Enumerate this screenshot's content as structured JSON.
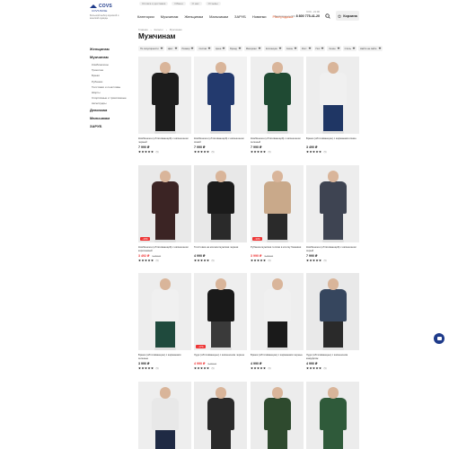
{
  "topbar": {
    "links": [
      "Оплата и доставка",
      "Обмен",
      "О нас",
      "Отзывы"
    ]
  },
  "header": {
    "brand": "COVS",
    "brand_sub": "COVS BASE",
    "tagline": "Большой выбор мужской и женской одежды",
    "nav": [
      "Категории",
      "Мужчинам",
      "Женщинам",
      "Мальчикам",
      "ЗАРУБ",
      "Новинки",
      "Распродажа"
    ],
    "hours": "9:00 - 21:00",
    "contact_label": "Бесплатно по РФ",
    "phone": "8 800 775-41-20",
    "cart_label": "Корзина"
  },
  "breadcrumb": [
    "Главная",
    "Каталог",
    "Мужчинам"
  ],
  "page_title": "Мужчинам",
  "sidebar": {
    "categories": [
      {
        "label": "Женщинам",
        "subs": []
      },
      {
        "label": "Мужчинам",
        "subs": [
          "Комбинезоны",
          "Трикотаж",
          "Брюки",
          "Рубашки",
          "Толстовки и лонгсливы",
          "Шорты",
          "Спортивные и трикотажные",
          "Аксессуары"
        ]
      },
      {
        "label": "Девочкам",
        "subs": []
      },
      {
        "label": "Мальчикам",
        "subs": []
      },
      {
        "label": "ЗАРУБ",
        "subs": []
      }
    ]
  },
  "filters": [
    "По популярности",
    "Цвет",
    "Размер",
    "Состав",
    "Цена",
    "Бренд",
    "Материал",
    "Коллекция",
    "Сезон",
    "Рост",
    "Пол",
    "Сезон",
    "Стиль",
    "Найти на сайте"
  ],
  "products": [
    {
      "name": "Комбинезон (обтягивающий) с капюшоном черный",
      "price": "7 990 ₽",
      "old": "",
      "rating_count": "(5)",
      "badge": "",
      "top": "#1d1d1d",
      "bottom": "#1d1d1d",
      "bg": "#eeeeee"
    },
    {
      "name": "Комбинезон (обтягивающий) с капюшоном синий",
      "price": "7 990 ₽",
      "old": "",
      "rating_count": "(5)",
      "badge": "",
      "top": "#233a6e",
      "bottom": "#233a6e",
      "bg": "#f2f2f2"
    },
    {
      "name": "Комбинезон (обтягивающий) с капюшоном зеленый",
      "price": "7 990 ₽",
      "old": "",
      "rating_count": "(5)",
      "badge": "",
      "top": "#1f4a33",
      "bottom": "#1f4a33",
      "bg": "#eeeeee"
    },
    {
      "name": "Брюки (обтягивающие) с карманами синие",
      "price": "3 490 ₽",
      "old": "",
      "rating_count": "(5)",
      "badge": "",
      "top": "#f0f0f0",
      "bottom": "#1f3664",
      "bg": "#ededed"
    },
    {
      "name": "Комбинезон (обтягивающий) с капюшоном коричневый",
      "price": "3 492 ₽",
      "old": "5 990 ₽",
      "rating_count": "(5)",
      "badge": "−40%",
      "top": "#3b2424",
      "bottom": "#3b2424",
      "bg": "#e9e9e9"
    },
    {
      "name": "Толстовка на молнии мужская черная",
      "price": "4 990 ₽",
      "old": "",
      "rating_count": "(5)",
      "badge": "",
      "top": "#1b1b1b",
      "bottom": "#2a2a2a",
      "bg": "#e8e8e8"
    },
    {
      "name": "Рубашка мужская теплая в клетку бежевая",
      "price": "3 990 ₽",
      "old": "5 990 ₽",
      "rating_count": "(5)",
      "badge": "−33%",
      "top": "#c9a98a",
      "bottom": "#2a2a2a",
      "bg": "#efefef"
    },
    {
      "name": "Комбинезон (обтягивающий) с капюшоном серый",
      "price": "7 990 ₽",
      "old": "",
      "rating_count": "(5)",
      "badge": "",
      "top": "#3e4452",
      "bottom": "#3e4452",
      "bg": "#ededed"
    },
    {
      "name": "Брюки (обтягивающие) с карманами зеленые",
      "price": "3 990 ₽",
      "old": "",
      "rating_count": "(5)",
      "badge": "",
      "top": "#f0f0f0",
      "bottom": "#1f4a3d",
      "bg": "#ededed"
    },
    {
      "name": "Худи (обтягивающее) с капюшоном черное",
      "price": "4 990 ₽",
      "old": "5 990 ₽",
      "rating_count": "(5)",
      "badge": "−17%",
      "top": "#1a1a1a",
      "bottom": "#3a3a3a",
      "bg": "#eeeeee"
    },
    {
      "name": "Брюки (обтягивающие) с карманами черные",
      "price": "4 990 ₽",
      "old": "",
      "rating_count": "(5)",
      "badge": "",
      "top": "#f0f0f0",
      "bottom": "#1a1a1a",
      "bg": "#eeeeee"
    },
    {
      "name": "Худи (обтягивающее) с капюшоном камуфляж",
      "price": "4 990 ₽",
      "old": "",
      "rating_count": "(5)",
      "badge": "",
      "top": "#36465e",
      "bottom": "#2a2a2a",
      "bg": "#e9e9e9"
    },
    {
      "name": "",
      "price": "",
      "old": "",
      "rating_count": "",
      "badge": "",
      "top": "#e8e8e8",
      "bottom": "#1f2a44",
      "bg": "#eeeeee"
    },
    {
      "name": "",
      "price": "",
      "old": "",
      "rating_count": "",
      "badge": "",
      "top": "#2a2a2a",
      "bottom": "#2a2a2a",
      "bg": "#ececec"
    },
    {
      "name": "",
      "price": "",
      "old": "",
      "rating_count": "",
      "badge": "",
      "top": "#2e4a2e",
      "bottom": "#2e4a2e",
      "bg": "#ececec"
    },
    {
      "name": "",
      "price": "",
      "old": "",
      "rating_count": "",
      "badge": "",
      "top": "#2f5a3a",
      "bottom": "#2f5a3a",
      "bg": "#ececec"
    }
  ],
  "colors": {
    "brand": "#1e3a8a",
    "sale": "#e35a2b",
    "discount": "#e33333"
  }
}
